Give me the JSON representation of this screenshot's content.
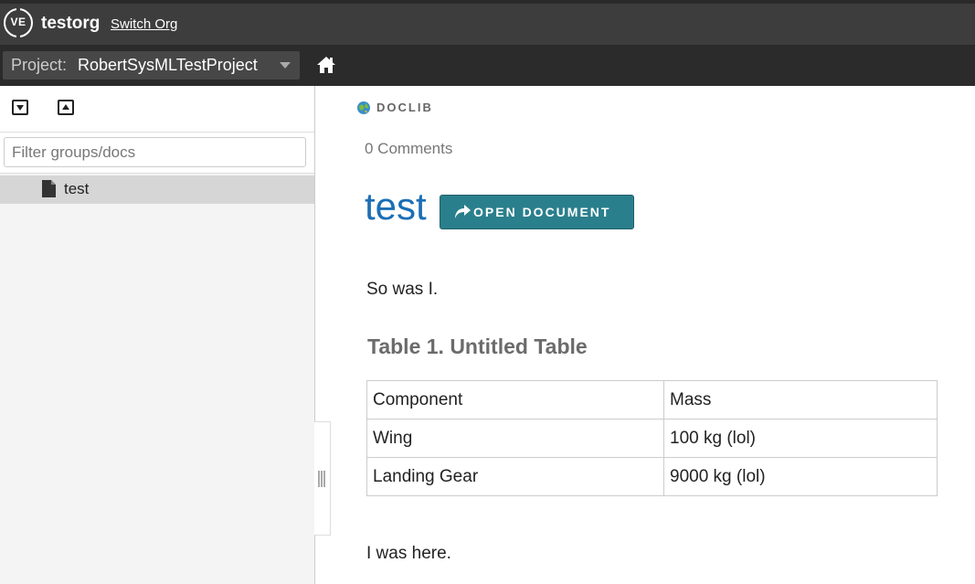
{
  "org": {
    "logo_text": "VE",
    "name": "testorg",
    "switch_label": "Switch Org"
  },
  "project": {
    "label": "Project:",
    "value": "RobertSysMLTestProject",
    "home_icon": "home-icon"
  },
  "sidebar": {
    "expand_icon": "expand-all-icon",
    "collapse_icon": "collapse-all-icon",
    "filter_placeholder": "Filter groups/docs",
    "items": [
      {
        "label": "test",
        "icon": "document-icon",
        "selected": true
      }
    ]
  },
  "main": {
    "section_label": "DOCLIB",
    "comments": "0 Comments",
    "title": "test",
    "open_button": "OPEN DOCUMENT",
    "paragraph_1": "So was I.",
    "table": {
      "caption": "Table 1. Untitled Table",
      "headers": [
        "Component",
        "Mass"
      ],
      "rows": [
        [
          "Wing",
          "100 kg (lol)"
        ],
        [
          "Landing Gear",
          "9000 kg (lol)"
        ]
      ]
    },
    "paragraph_2": "I was here."
  },
  "colors": {
    "org_bar": "#3d3d3d",
    "project_bar": "#2b2b2b",
    "title_blue": "#1b6fb5",
    "button_teal": "#2a7f8c"
  }
}
